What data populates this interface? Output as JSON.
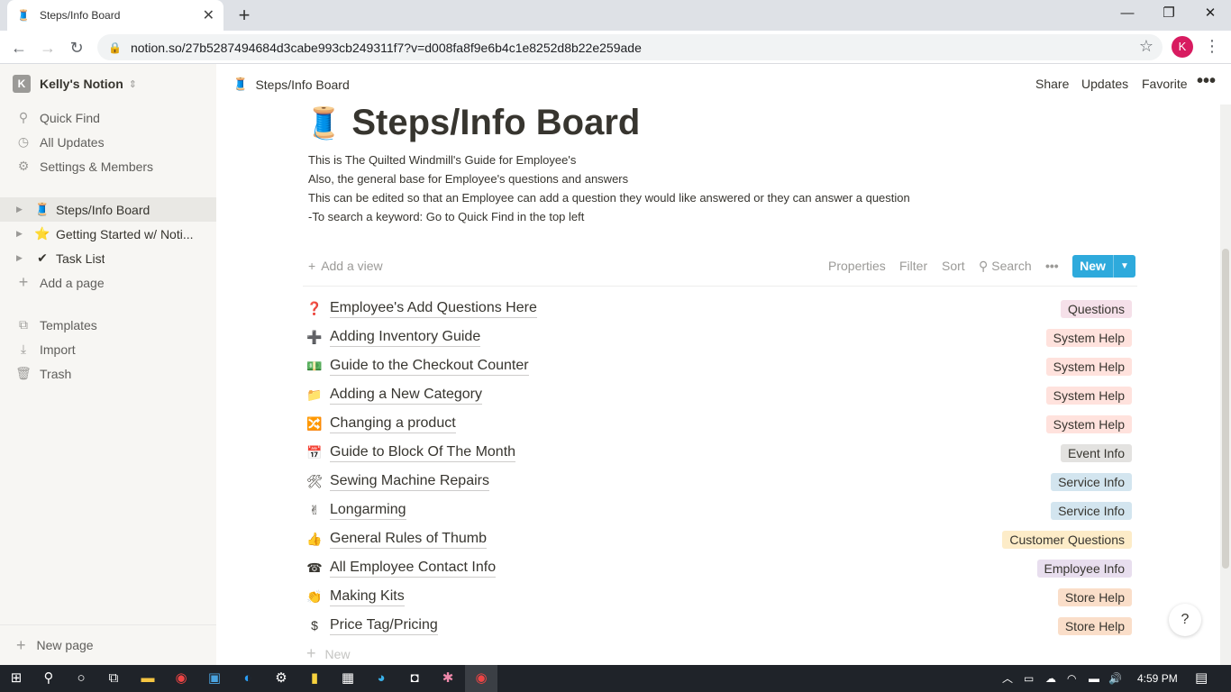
{
  "browser": {
    "tab_title": "Steps/Info Board",
    "url": "notion.so/27b5287494684d3cabe993cb249311f7?v=d008fa8f9e6b4c1e8252d8b22e259ade",
    "profile_initial": "K"
  },
  "sidebar": {
    "workspace_initial": "K",
    "workspace_name": "Kelly's Notion",
    "nav": [
      {
        "label": "Quick Find",
        "icon": "search-icon"
      },
      {
        "label": "All Updates",
        "icon": "clock-icon"
      },
      {
        "label": "Settings & Members",
        "icon": "gear-icon"
      }
    ],
    "pages": [
      {
        "label": "Steps/Info Board",
        "icon": "🧵",
        "active": true
      },
      {
        "label": "Getting Started w/ Noti...",
        "icon": "⭐"
      },
      {
        "label": "Task List",
        "icon": "✔"
      }
    ],
    "add_page": "Add a page",
    "utilities": [
      {
        "label": "Templates",
        "icon": "templates-icon"
      },
      {
        "label": "Import",
        "icon": "import-icon"
      },
      {
        "label": "Trash",
        "icon": "trash-icon"
      }
    ],
    "new_page": "New page"
  },
  "topbar": {
    "breadcrumb": "Steps/Info Board",
    "share": "Share",
    "updates": "Updates",
    "favorite": "Favorite"
  },
  "page": {
    "icon": "🧵",
    "title": "Steps/Info Board",
    "description": [
      "This is The Quilted Windmill's Guide for Employee's",
      "Also, the general base for Employee's questions and answers",
      "This can be edited so that an Employee can add a question they would like answered or they can answer a question",
      "-To search a keyword: Go to Quick Find in the top left"
    ]
  },
  "viewbar": {
    "add_view": "Add a view",
    "properties": "Properties",
    "filter": "Filter",
    "sort": "Sort",
    "search": "Search",
    "new": "New"
  },
  "rows": [
    {
      "icon": "❓",
      "title": "Employee's Add Questions Here",
      "tag": "Questions",
      "tag_color": "#f5e0e9"
    },
    {
      "icon": "➕",
      "title": "Adding Inventory Guide",
      "tag": "System Help",
      "tag_color": "#ffe2dd"
    },
    {
      "icon": "💵",
      "title": "Guide to the Checkout Counter",
      "tag": "System Help",
      "tag_color": "#ffe2dd"
    },
    {
      "icon": "📁",
      "title": "Adding a New Category",
      "tag": "System Help",
      "tag_color": "#ffe2dd"
    },
    {
      "icon": "🔀",
      "title": "Changing a product",
      "tag": "System Help",
      "tag_color": "#ffe2dd"
    },
    {
      "icon": "📅",
      "title": "Guide to Block Of The Month",
      "tag": "Event Info",
      "tag_color": "#e3e2e0"
    },
    {
      "icon": "🛠",
      "title": "Sewing Machine Repairs",
      "tag": "Service Info",
      "tag_color": "#d3e5ef"
    },
    {
      "icon": "✌",
      "title": "Longarming",
      "tag": "Service Info",
      "tag_color": "#d3e5ef"
    },
    {
      "icon": "👍",
      "title": "General Rules of Thumb",
      "tag": "Customer Questions",
      "tag_color": "#fdecc8"
    },
    {
      "icon": "☎",
      "title": "All Employee Contact Info",
      "tag": "Employee Info",
      "tag_color": "#e8deee"
    },
    {
      "icon": "👏",
      "title": "Making Kits",
      "tag": "Store Help",
      "tag_color": "#fadec9"
    },
    {
      "icon": "$",
      "title": "Price Tag/Pricing",
      "tag": "Store Help",
      "tag_color": "#fadec9"
    }
  ],
  "new_row": "New",
  "help": "?",
  "taskbar": {
    "time": "4:59 PM"
  }
}
